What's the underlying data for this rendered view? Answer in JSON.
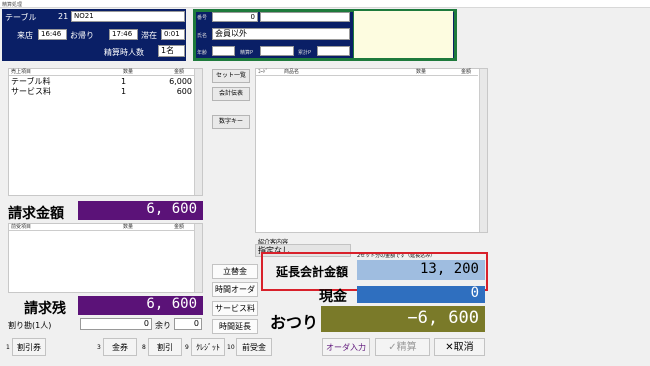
{
  "window": {
    "title": "精算処理"
  },
  "table": {
    "label": "テーブル",
    "number": "21",
    "name": "NO21",
    "arrive_label": "来店",
    "arrive": "16:46",
    "leave_label": "お帰り",
    "leave": "17:46",
    "stay_label": "滞在",
    "stay": "0:01",
    "count_label": "精算時人数",
    "count": "1名"
  },
  "customer": {
    "no_label": "番号",
    "no": "0",
    "name_label": "氏名",
    "name": "会員以外",
    "age_label": "年齢",
    "points_label": "精算P",
    "total_points_label": "累計P"
  },
  "sales": {
    "headers": [
      "売上項目",
      "数量",
      "金額"
    ],
    "rows": [
      {
        "item": "テーブル料",
        "qty": "1",
        "amount": "6,000"
      },
      {
        "item": "サービス料",
        "qty": "1",
        "amount": "600"
      }
    ]
  },
  "middle_buttons": {
    "set_list": "セット一覧",
    "accounting": "会計伝表",
    "numeric_key": "数字キー"
  },
  "product_list": {
    "headers": [
      "ｺｰﾄﾞ",
      "商品名",
      "数量",
      "金額"
    ]
  },
  "invoice": {
    "label": "請求金額",
    "amount": "6, 600"
  },
  "prepaid_list": {
    "headers": [
      "前受項目",
      "数量",
      "金額"
    ]
  },
  "introducer": {
    "label": "紹介客内容",
    "value": "指定なし"
  },
  "note": "2セット分の金額です（延長込み）",
  "extension": {
    "label": "延長会計金額",
    "amount": "13, 200"
  },
  "cash": {
    "label": "現金",
    "amount": "0"
  },
  "change": {
    "label": "おつり",
    "amount": "−6, 600"
  },
  "balance": {
    "label": "請求残",
    "amount": "6, 600"
  },
  "split": {
    "label": "割り勘(1人)",
    "value": "0",
    "remainder_label": "余り",
    "remainder": "0"
  },
  "action_buttons": {
    "advance": "立替金",
    "time_order": "時間オーダー",
    "service_fee": "サービス料",
    "time_extend": "時間延長"
  },
  "bottom": {
    "k1": "1",
    "b1": "割引券",
    "k3": "3",
    "b3": "金券",
    "k8": "8",
    "b8": "割引",
    "k9": "9",
    "b9": "ｸﾚｼﾞｯﾄ",
    "k10": "10",
    "b10": "前受金",
    "order_input": "オーダ入力",
    "settle": "✓精算",
    "cancel": "✕取消"
  }
}
